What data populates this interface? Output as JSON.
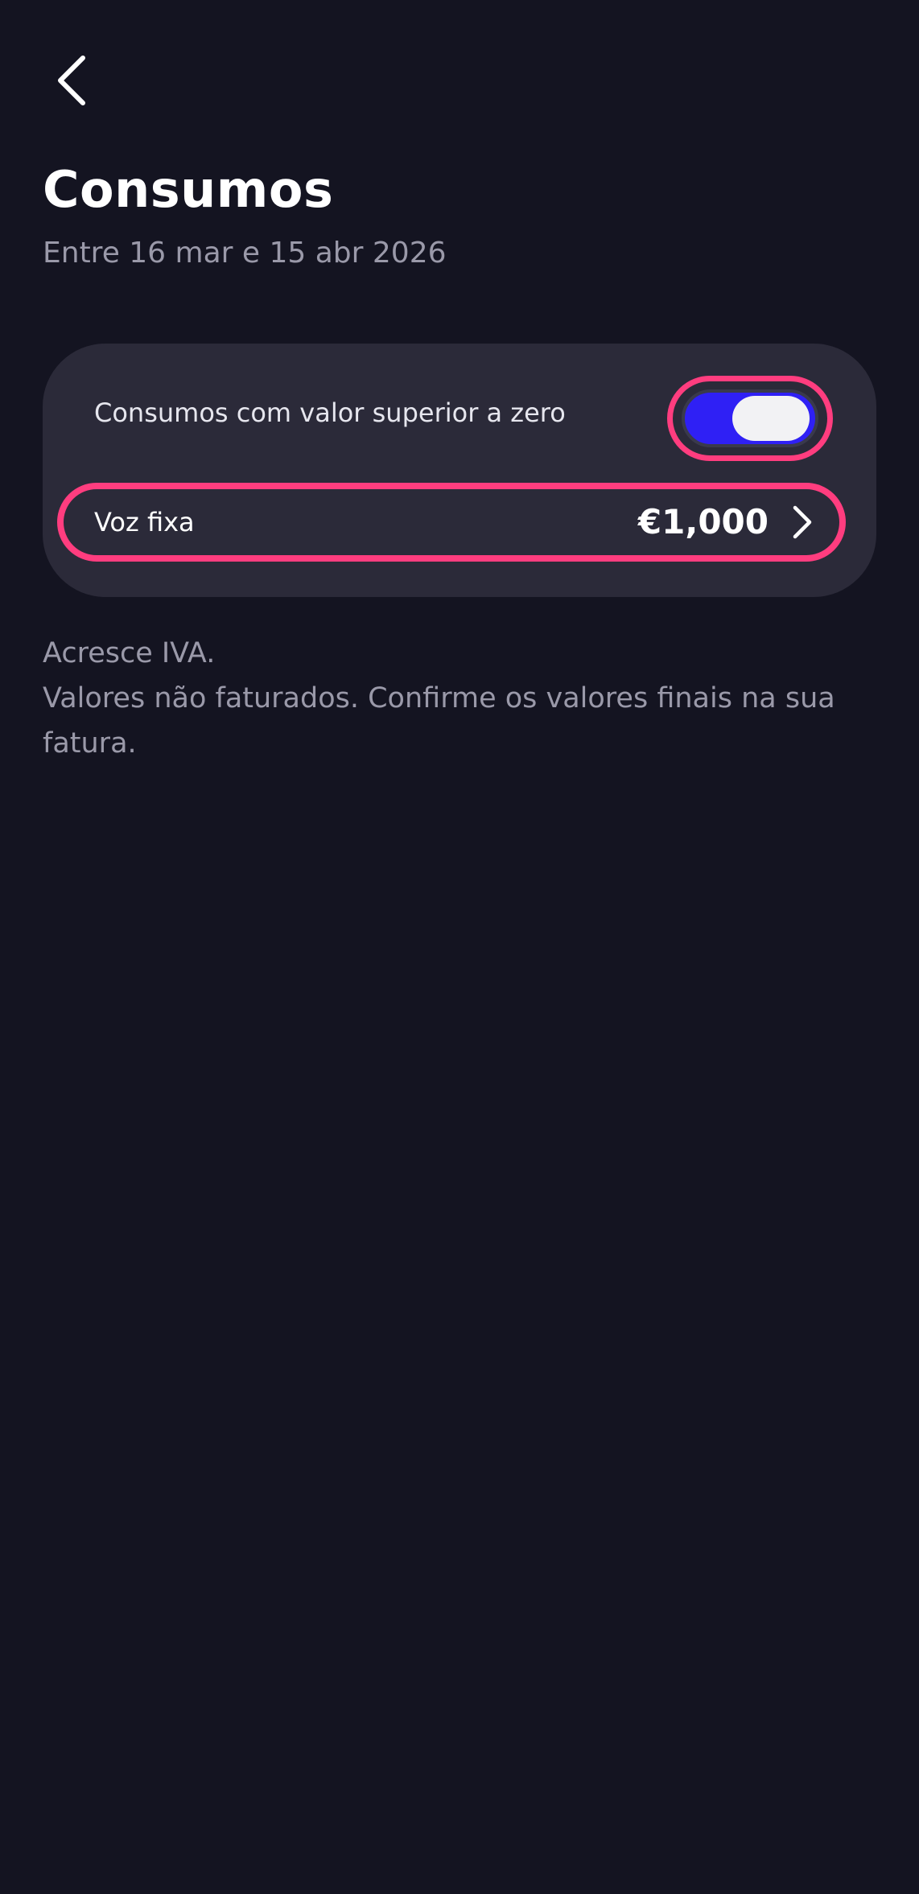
{
  "header": {
    "back_icon": "chevron-left-icon",
    "title": "Consumos",
    "subtitle": "Entre 16 mar e 15 abr 2026"
  },
  "card": {
    "filter_label": "Consumos com valor superior a zero",
    "toggle_on": true,
    "toggle_color": "#2f20f5",
    "highlight_color": "#ff3d7f",
    "items": [
      {
        "label": "Voz fixa",
        "value": "€1,000",
        "icon": "chevron-right-icon"
      }
    ]
  },
  "notes": {
    "line1": "Acresce IVA.",
    "line2": "Valores não faturados. Confirme os valores finais na sua fatura."
  }
}
